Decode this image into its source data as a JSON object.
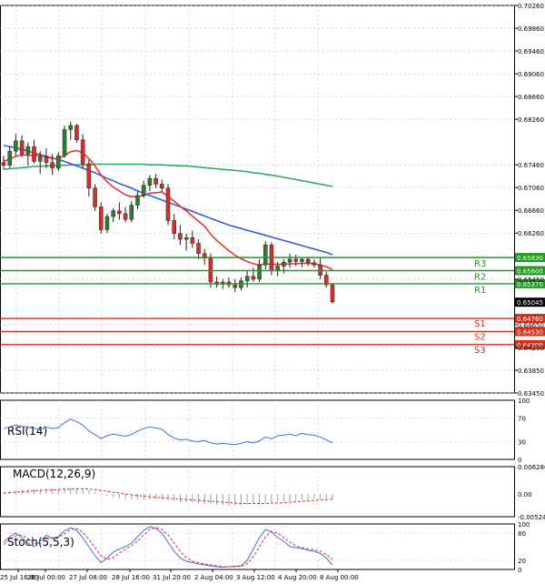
{
  "chart_data": {
    "type": "candlestick",
    "colors": {
      "background": "#ffffff",
      "grid": "#b8b8b8",
      "up_candle": "#2e7d32",
      "down_candle": "#d32f2f",
      "ma_fast": "#e53935",
      "ma_mid": "#3b5bdb",
      "ma_slow": "#2fa866",
      "resistance": "#1f9a1f",
      "support": "#d62c1a",
      "rsi": "#3f6fd8",
      "macd": "#d32f2f",
      "stoch_main": "#3f6fd8",
      "stoch_signal": "#d32f2f"
    },
    "price": {
      "ylim": [
        0.6345,
        0.7026
      ],
      "ticks": [
        "0.70260",
        "0.69860",
        "0.69460",
        "0.69060",
        "0.68660",
        "0.68260",
        "0.67460",
        "0.67060",
        "0.66660",
        "0.66260",
        "0.65450",
        "0.64650",
        "0.64250",
        "0.63850",
        "0.63450"
      ],
      "current_label": "0.65045",
      "current_value": 0.65045,
      "levels": [
        {
          "label": "R3",
          "value": 0.6583,
          "tag": "0.65830",
          "kind": "resistance"
        },
        {
          "label": "R2",
          "value": 0.656,
          "tag": "0.65600",
          "kind": "resistance"
        },
        {
          "label": "R1",
          "value": 0.6537,
          "tag": "0.65370",
          "kind": "resistance"
        },
        {
          "label": "S1",
          "value": 0.6476,
          "tag": "0.64760",
          "kind": "support"
        },
        {
          "label": "S2",
          "value": 0.6453,
          "tag": "0.64530",
          "kind": "support"
        },
        {
          "label": "S3",
          "value": 0.643,
          "tag": "0.64300",
          "kind": "support"
        }
      ],
      "candles": [
        {
          "o": 0.675,
          "h": 0.6762,
          "l": 0.6738,
          "c": 0.6745
        },
        {
          "o": 0.6745,
          "h": 0.6778,
          "l": 0.674,
          "c": 0.677
        },
        {
          "o": 0.677,
          "h": 0.68,
          "l": 0.6762,
          "c": 0.6788
        },
        {
          "o": 0.6788,
          "h": 0.6798,
          "l": 0.676,
          "c": 0.6765
        },
        {
          "o": 0.6765,
          "h": 0.6785,
          "l": 0.6745,
          "c": 0.6778
        },
        {
          "o": 0.6778,
          "h": 0.679,
          "l": 0.6748,
          "c": 0.6752
        },
        {
          "o": 0.6752,
          "h": 0.677,
          "l": 0.673,
          "c": 0.676
        },
        {
          "o": 0.676,
          "h": 0.6775,
          "l": 0.674,
          "c": 0.675
        },
        {
          "o": 0.675,
          "h": 0.6765,
          "l": 0.6728,
          "c": 0.674
        },
        {
          "o": 0.674,
          "h": 0.6768,
          "l": 0.6735,
          "c": 0.6762
        },
        {
          "o": 0.6762,
          "h": 0.6815,
          "l": 0.6758,
          "c": 0.6808
        },
        {
          "o": 0.6808,
          "h": 0.6822,
          "l": 0.679,
          "c": 0.6815
        },
        {
          "o": 0.6815,
          "h": 0.6818,
          "l": 0.6785,
          "c": 0.679
        },
        {
          "o": 0.679,
          "h": 0.68,
          "l": 0.674,
          "c": 0.6748
        },
        {
          "o": 0.6748,
          "h": 0.6755,
          "l": 0.669,
          "c": 0.6705
        },
        {
          "o": 0.6705,
          "h": 0.6712,
          "l": 0.6665,
          "c": 0.6672
        },
        {
          "o": 0.6672,
          "h": 0.668,
          "l": 0.6625,
          "c": 0.6632
        },
        {
          "o": 0.6632,
          "h": 0.666,
          "l": 0.6626,
          "c": 0.6655
        },
        {
          "o": 0.6655,
          "h": 0.667,
          "l": 0.6645,
          "c": 0.6665
        },
        {
          "o": 0.6665,
          "h": 0.668,
          "l": 0.665,
          "c": 0.666
        },
        {
          "o": 0.666,
          "h": 0.6672,
          "l": 0.6645,
          "c": 0.665
        },
        {
          "o": 0.665,
          "h": 0.6682,
          "l": 0.6645,
          "c": 0.6675
        },
        {
          "o": 0.6675,
          "h": 0.67,
          "l": 0.6668,
          "c": 0.6692
        },
        {
          "o": 0.6692,
          "h": 0.6718,
          "l": 0.6688,
          "c": 0.671
        },
        {
          "o": 0.671,
          "h": 0.6728,
          "l": 0.67,
          "c": 0.6722
        },
        {
          "o": 0.6722,
          "h": 0.673,
          "l": 0.6705,
          "c": 0.6712
        },
        {
          "o": 0.6712,
          "h": 0.672,
          "l": 0.6698,
          "c": 0.6705
        },
        {
          "o": 0.6705,
          "h": 0.6712,
          "l": 0.664,
          "c": 0.6648
        },
        {
          "o": 0.6648,
          "h": 0.666,
          "l": 0.6615,
          "c": 0.6625
        },
        {
          "o": 0.6625,
          "h": 0.664,
          "l": 0.6605,
          "c": 0.6615
        },
        {
          "o": 0.6615,
          "h": 0.6625,
          "l": 0.6595,
          "c": 0.6618
        },
        {
          "o": 0.6618,
          "h": 0.663,
          "l": 0.66,
          "c": 0.6608
        },
        {
          "o": 0.6608,
          "h": 0.6615,
          "l": 0.658,
          "c": 0.659
        },
        {
          "o": 0.659,
          "h": 0.6598,
          "l": 0.657,
          "c": 0.6582
        },
        {
          "o": 0.6582,
          "h": 0.659,
          "l": 0.653,
          "c": 0.654
        },
        {
          "o": 0.654,
          "h": 0.655,
          "l": 0.653,
          "c": 0.6536
        },
        {
          "o": 0.6536,
          "h": 0.6545,
          "l": 0.6528,
          "c": 0.654
        },
        {
          "o": 0.654,
          "h": 0.6548,
          "l": 0.653,
          "c": 0.6535
        },
        {
          "o": 0.6535,
          "h": 0.6545,
          "l": 0.6522,
          "c": 0.653
        },
        {
          "o": 0.653,
          "h": 0.6548,
          "l": 0.6525,
          "c": 0.6542
        },
        {
          "o": 0.6542,
          "h": 0.656,
          "l": 0.653,
          "c": 0.655
        },
        {
          "o": 0.655,
          "h": 0.6565,
          "l": 0.654,
          "c": 0.6545
        },
        {
          "o": 0.6545,
          "h": 0.658,
          "l": 0.654,
          "c": 0.657
        },
        {
          "o": 0.657,
          "h": 0.6612,
          "l": 0.6562,
          "c": 0.6605
        },
        {
          "o": 0.6605,
          "h": 0.661,
          "l": 0.6552,
          "c": 0.656
        },
        {
          "o": 0.656,
          "h": 0.6575,
          "l": 0.655,
          "c": 0.6568
        },
        {
          "o": 0.6568,
          "h": 0.658,
          "l": 0.6555,
          "c": 0.6575
        },
        {
          "o": 0.6575,
          "h": 0.659,
          "l": 0.6565,
          "c": 0.658
        },
        {
          "o": 0.658,
          "h": 0.6588,
          "l": 0.6568,
          "c": 0.6576
        },
        {
          "o": 0.6576,
          "h": 0.6584,
          "l": 0.6566,
          "c": 0.658
        },
        {
          "o": 0.658,
          "h": 0.6584,
          "l": 0.6568,
          "c": 0.6574
        },
        {
          "o": 0.6574,
          "h": 0.658,
          "l": 0.6565,
          "c": 0.657
        },
        {
          "o": 0.657,
          "h": 0.6582,
          "l": 0.6545,
          "c": 0.6552
        },
        {
          "o": 0.6552,
          "h": 0.6558,
          "l": 0.653,
          "c": 0.6535
        },
        {
          "o": 0.6535,
          "h": 0.6538,
          "l": 0.6502,
          "c": 0.6505
        }
      ],
      "ma_fast": [
        0.6752,
        0.6756,
        0.6761,
        0.6763,
        0.6763,
        0.6762,
        0.6762,
        0.676,
        0.6757,
        0.6757,
        0.6762,
        0.6769,
        0.6771,
        0.6767,
        0.6757,
        0.6744,
        0.6728,
        0.6716,
        0.6707,
        0.67,
        0.6693,
        0.669,
        0.669,
        0.6692,
        0.6696,
        0.6697,
        0.6698,
        0.6691,
        0.6682,
        0.6673,
        0.6665,
        0.6656,
        0.6647,
        0.6638,
        0.6624,
        0.6613,
        0.6604,
        0.6595,
        0.6587,
        0.6581,
        0.6576,
        0.6572,
        0.657,
        0.6572,
        0.6571,
        0.6571,
        0.6571,
        0.6572,
        0.6572,
        0.6573,
        0.6573,
        0.6572,
        0.657,
        0.6567,
        0.6562
      ],
      "ma_mid": [
        0.678,
        0.6778,
        0.6776,
        0.6773,
        0.677,
        0.6767,
        0.6764,
        0.6761,
        0.6758,
        0.6755,
        0.6752,
        0.6748,
        0.6744,
        0.674,
        0.6736,
        0.6732,
        0.6727,
        0.6722,
        0.6718,
        0.6713,
        0.6709,
        0.6705,
        0.67,
        0.6696,
        0.6692,
        0.6688,
        0.6684,
        0.668,
        0.6676,
        0.6672,
        0.6668,
        0.6664,
        0.666,
        0.6656,
        0.6652,
        0.6648,
        0.6644,
        0.664,
        0.6637,
        0.6634,
        0.6631,
        0.6628,
        0.6625,
        0.6622,
        0.6619,
        0.6616,
        0.6613,
        0.661,
        0.6607,
        0.6604,
        0.6601,
        0.6598,
        0.6595,
        0.6592,
        0.6588
      ],
      "ma_slow": [
        0.6738,
        0.6739,
        0.674,
        0.6741,
        0.6742,
        0.6743,
        0.6743,
        0.6744,
        0.6744,
        0.6745,
        0.6745,
        0.6746,
        0.6746,
        0.6746,
        0.6746,
        0.6747,
        0.6747,
        0.6747,
        0.6747,
        0.6747,
        0.6747,
        0.6747,
        0.6747,
        0.6747,
        0.6746,
        0.6746,
        0.6746,
        0.6745,
        0.6745,
        0.6744,
        0.6744,
        0.6743,
        0.6742,
        0.6741,
        0.674,
        0.6739,
        0.6738,
        0.6737,
        0.6736,
        0.6735,
        0.6734,
        0.6732,
        0.6731,
        0.6729,
        0.6728,
        0.6726,
        0.6724,
        0.6722,
        0.672,
        0.6718,
        0.6716,
        0.6714,
        0.6712,
        0.671,
        0.6708
      ]
    },
    "x_ticks": [
      "25 Jul 16:00",
      "26 Jul 00:00",
      "27 Jul 08:00",
      "28 Jul 16:00",
      "31 Jul 20:00",
      "2 Aug 04:00",
      "3 Aug 12:00",
      "4 Aug 20:00",
      "8 Aug 00:00"
    ],
    "rsi": {
      "label": "RSI(14)",
      "ticks": [
        "100",
        "70",
        "30",
        "0"
      ],
      "ylim": [
        0,
        100
      ],
      "values": [
        52,
        55,
        58,
        56,
        54,
        53,
        50,
        55,
        52,
        54,
        62,
        68,
        64,
        58,
        48,
        42,
        35,
        40,
        43,
        41,
        39,
        42,
        48,
        52,
        55,
        53,
        51,
        42,
        36,
        33,
        34,
        31,
        30,
        32,
        28,
        26,
        27,
        26,
        25,
        27,
        30,
        28,
        31,
        38,
        35,
        40,
        41,
        43,
        40,
        44,
        42,
        41,
        38,
        33,
        28
      ]
    },
    "macd": {
      "label": "MACD(12,26,9)",
      "ticks": [
        "0.006286",
        "0.00",
        "-0.005248"
      ],
      "ylim": [
        -0.005248,
        0.006286
      ],
      "hist": [
        0.0004,
        0.0006,
        0.0008,
        0.0009,
        0.001,
        0.0011,
        0.0012,
        0.0012,
        0.0013,
        0.0013,
        0.0014,
        0.0015,
        0.0014,
        0.0012,
        0.0008,
        0.0004,
        -0.0001,
        -0.0005,
        -0.0008,
        -0.001,
        -0.0012,
        -0.0013,
        -0.0013,
        -0.0013,
        -0.0012,
        -0.0012,
        -0.0012,
        -0.0014,
        -0.0016,
        -0.0018,
        -0.0019,
        -0.002,
        -0.0021,
        -0.0022,
        -0.0024,
        -0.0025,
        -0.0026,
        -0.0026,
        -0.0026,
        -0.0025,
        -0.0024,
        -0.0023,
        -0.0022,
        -0.002,
        -0.0019,
        -0.0018,
        -0.0017,
        -0.0016,
        -0.0015,
        -0.0014,
        -0.0013,
        -0.0012,
        -0.0011,
        -0.0011,
        -0.0012
      ],
      "signal": [
        0.0002,
        0.0003,
        0.0004,
        0.0005,
        0.0006,
        0.0007,
        0.0008,
        0.0009,
        0.0009,
        0.001,
        0.0011,
        0.0011,
        0.0012,
        0.0012,
        0.0011,
        0.001,
        0.0008,
        0.0006,
        0.0004,
        0.0002,
        0.0,
        -0.0002,
        -0.0004,
        -0.0005,
        -0.0007,
        -0.0008,
        -0.0009,
        -0.001,
        -0.0011,
        -0.0012,
        -0.0013,
        -0.0014,
        -0.0015,
        -0.0016,
        -0.0017,
        -0.0018,
        -0.0019,
        -0.002,
        -0.0021,
        -0.0022,
        -0.0022,
        -0.0022,
        -0.0022,
        -0.0022,
        -0.0021,
        -0.0021,
        -0.002,
        -0.0019,
        -0.0018,
        -0.0017,
        -0.0016,
        -0.0015,
        -0.0014,
        -0.0013,
        -0.0012
      ]
    },
    "stoch": {
      "label": "Stoch(5,5,3)",
      "ticks": [
        "100",
        "80",
        "20",
        "0"
      ],
      "ylim": [
        0,
        100
      ],
      "main": [
        60,
        72,
        80,
        70,
        58,
        50,
        62,
        75,
        68,
        72,
        85,
        92,
        86,
        70,
        50,
        30,
        15,
        25,
        38,
        45,
        50,
        58,
        72,
        86,
        94,
        90,
        80,
        60,
        40,
        25,
        18,
        15,
        12,
        10,
        8,
        6,
        5,
        6,
        7,
        8,
        20,
        45,
        70,
        88,
        82,
        70,
        62,
        50,
        48,
        46,
        42,
        40,
        35,
        25,
        10
      ],
      "signal": [
        55,
        65,
        74,
        76,
        68,
        58,
        56,
        66,
        70,
        71,
        78,
        88,
        90,
        82,
        66,
        48,
        30,
        22,
        26,
        36,
        44,
        52,
        62,
        76,
        88,
        92,
        88,
        76,
        58,
        40,
        26,
        18,
        15,
        12,
        10,
        8,
        6,
        6,
        6,
        7,
        12,
        28,
        50,
        72,
        84,
        80,
        70,
        60,
        52,
        48,
        45,
        43,
        40,
        33,
        22
      ]
    }
  }
}
